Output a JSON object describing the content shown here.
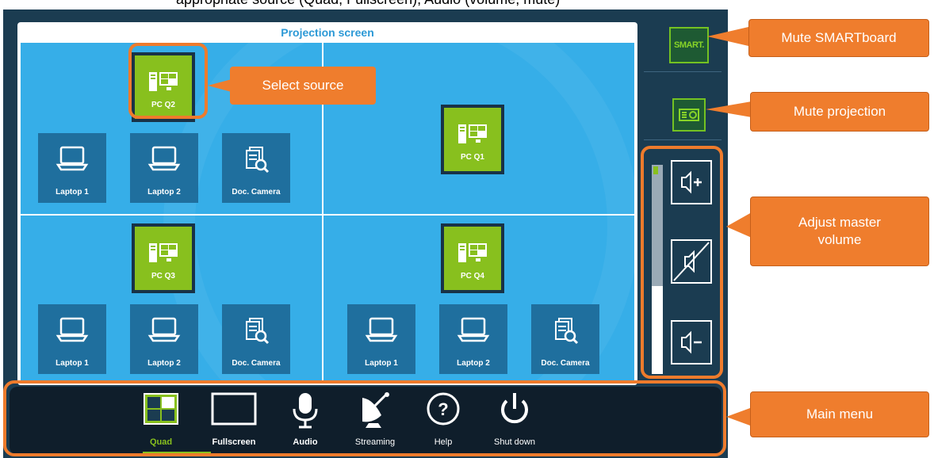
{
  "caption": "appropriate source (Quad, Fullscreen), Audio (volume, mute)",
  "projection": {
    "title": "Projection screen"
  },
  "quadrants": {
    "q1": {
      "pc_label": "PC Q2",
      "sources": [
        "Laptop 1",
        "Laptop 2",
        "Doc. Camera"
      ]
    },
    "q2": {
      "pc_label": "PC Q1"
    },
    "q3": {
      "pc_label": "PC Q3",
      "sources": [
        "Laptop 1",
        "Laptop 2",
        "Doc. Camera"
      ]
    },
    "q4": {
      "pc_label": "PC Q4",
      "sources": [
        "Laptop 1",
        "Laptop 2",
        "Doc. Camera"
      ]
    }
  },
  "side": {
    "smart_logo": "SMART."
  },
  "volume": {
    "level": 0.42
  },
  "menu": {
    "items": [
      {
        "label": "Quad",
        "icon": "quad-icon",
        "active": true
      },
      {
        "label": "Fullscreen",
        "icon": "fullscreen-icon"
      },
      {
        "label": "Audio",
        "icon": "microphone-icon"
      },
      {
        "label": "Streaming",
        "icon": "satellite-dish-icon"
      },
      {
        "label": "Help",
        "icon": "help-icon"
      },
      {
        "label": "Shut down",
        "icon": "power-icon"
      }
    ]
  },
  "callouts": {
    "select_source": "Select source",
    "mute_smartboard": "Mute SMARTboard",
    "mute_projection": "Mute projection",
    "adjust_master_volume": "Adjust master\nvolume",
    "main_menu": "Main menu"
  },
  "colors": {
    "accent_green": "#88c01e",
    "callout_orange": "#ef7d2d",
    "panel_dark": "#1b3c51",
    "screen_blue": "#36aee8"
  }
}
